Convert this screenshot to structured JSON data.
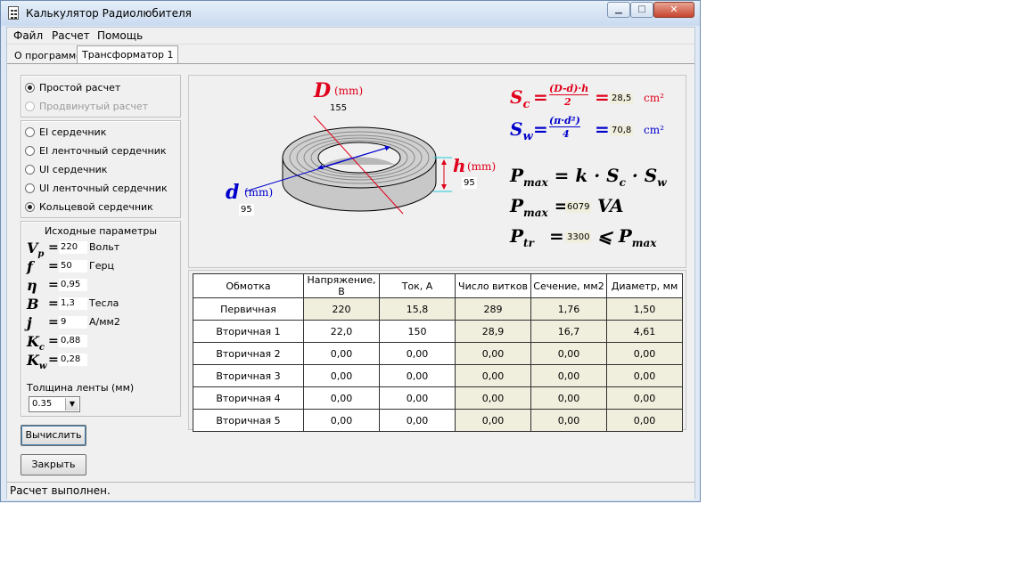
{
  "window": {
    "title": "Калькулятор Радиолюбителя"
  },
  "menu": [
    "Файл",
    "Расчет",
    "Помощь"
  ],
  "tabs": [
    "О программе",
    "Трансформатор 1"
  ],
  "calc_mode": {
    "simple": "Простой расчет",
    "advanced": "Продвинутый расчет",
    "selected": "Простой расчет"
  },
  "core_types": {
    "items": [
      "EI сердечник",
      "EI ленточный сердечник",
      "UI сердечник",
      "UI ленточный сердечник",
      "Кольцевой сердечник"
    ],
    "selected": "Кольцевой сердечник"
  },
  "params": {
    "title": "Исходные параметры",
    "rows": [
      {
        "symbol": "V",
        "sub": "p",
        "value": "220",
        "unit": "Вольт"
      },
      {
        "symbol": "f",
        "sub": "",
        "value": "50",
        "unit": "Герц"
      },
      {
        "symbol": "η",
        "sub": "",
        "value": "0,95",
        "unit": ""
      },
      {
        "symbol": "B",
        "sub": "",
        "value": "1,3",
        "unit": "Тесла"
      },
      {
        "symbol": "j",
        "sub": "",
        "value": "9",
        "unit": "А/мм2"
      },
      {
        "symbol": "K",
        "sub": "c",
        "value": "0,88",
        "unit": ""
      },
      {
        "symbol": "K",
        "sub": "w",
        "value": "0,28",
        "unit": ""
      }
    ],
    "tape_label": "Толщина ленты (мм)",
    "tape_value": "0.35"
  },
  "buttons": {
    "calculate": "Вычислить",
    "close": "Закрыть"
  },
  "toroid": {
    "D_label": "D",
    "D_unit": "(mm)",
    "D_value": "155",
    "d_label": "d",
    "d_unit": "(mm)",
    "d_value": "95",
    "h_label": "h",
    "h_unit": "(mm)",
    "h_value": "95"
  },
  "formulas": {
    "sc_value": "28,5",
    "sw_value": "70,8",
    "area_unit": "cm²",
    "pmax_value": "6079",
    "pmax_unit": "VA",
    "ptr_value": "3300"
  },
  "table": {
    "headers": [
      "Обмотка",
      "Напряжение, В",
      "Ток, А",
      "Число витков",
      "Сечение, мм2",
      "Диаметр, мм"
    ],
    "rows": [
      [
        "Первичная",
        "220",
        "15,8",
        "289",
        "1,76",
        "1,50"
      ],
      [
        "Вторичная 1",
        "22,0",
        "150",
        "28,9",
        "16,7",
        "4,61"
      ],
      [
        "Вторичная 2",
        "0,00",
        "0,00",
        "0,00",
        "0,00",
        "0,00"
      ],
      [
        "Вторичная 3",
        "0,00",
        "0,00",
        "0,00",
        "0,00",
        "0,00"
      ],
      [
        "Вторичная 4",
        "0,00",
        "0,00",
        "0,00",
        "0,00",
        "0,00"
      ],
      [
        "Вторичная 5",
        "0,00",
        "0,00",
        "0,00",
        "0,00",
        "0,00"
      ]
    ]
  },
  "status": "Расчет выполнен.",
  "colors": {
    "red": "#e0001b",
    "blue": "#0000cc",
    "cell_beige": "#f0eedc"
  }
}
